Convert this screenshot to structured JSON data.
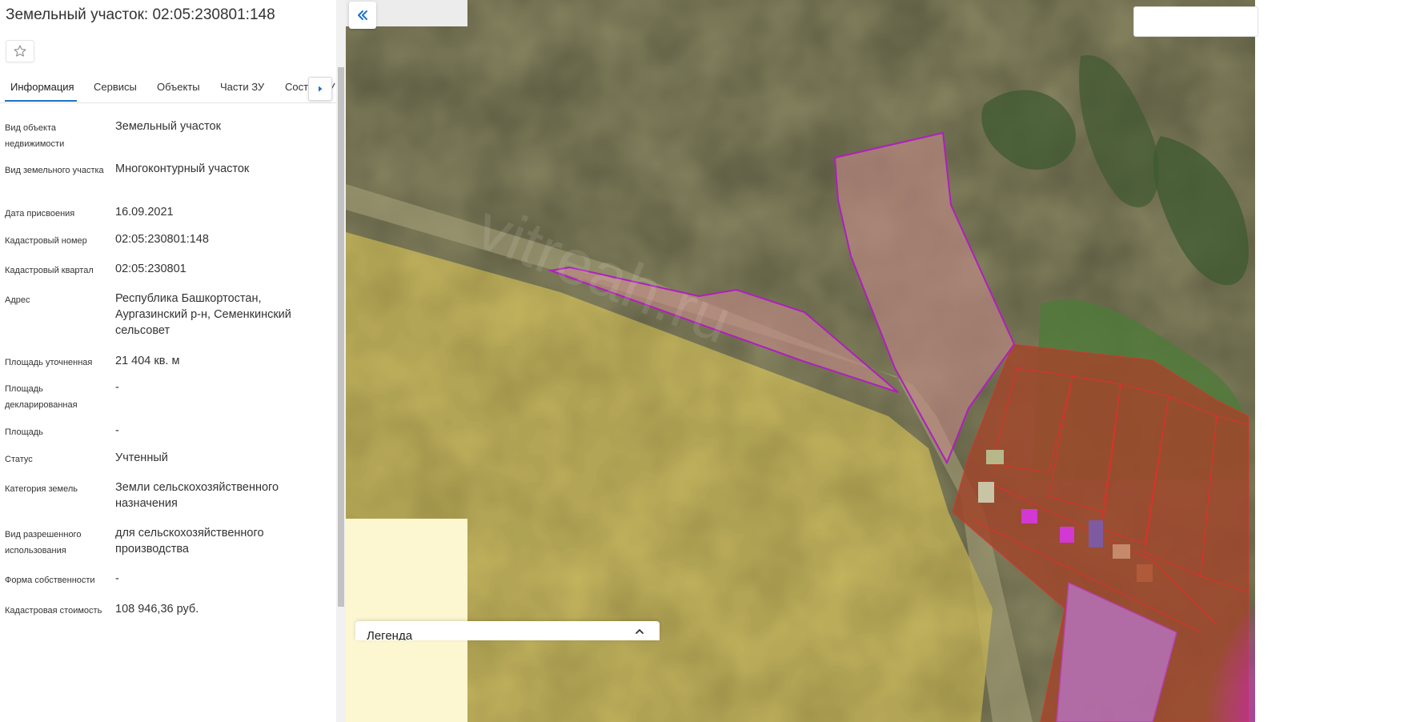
{
  "panel": {
    "title": "Земельный участок: 02:05:230801:148",
    "favorite_icon": "star-icon",
    "tabs": [
      {
        "label": "Информация",
        "active": true
      },
      {
        "label": "Сервисы"
      },
      {
        "label": "Объекты"
      },
      {
        "label": "Части ЗУ"
      },
      {
        "label": "Состав ЗУ"
      }
    ],
    "tabs_next_icon": "caret-right-icon",
    "fields": [
      {
        "label": "Вид объекта недвижимости",
        "value": "Земельный участок"
      },
      {
        "label": "Вид земельного участка",
        "value": "Многоконтурный участок"
      },
      {
        "label": "Дата присвоения",
        "value": "16.09.2021"
      },
      {
        "label": "Кадастровый номер",
        "value": "02:05:230801:148"
      },
      {
        "label": "Кадастровый квартал",
        "value": "02:05:230801"
      },
      {
        "label": "Адрес",
        "value": "Республика Башкортостан, Аургазинский р-н, Семенкинский сельсовет"
      },
      {
        "label": "Площадь уточненная",
        "value": "21 404 кв. м"
      },
      {
        "label": "Площадь декларированная",
        "value": "-"
      },
      {
        "label": "Площадь",
        "value": "-"
      },
      {
        "label": "Статус",
        "value": "Учтенный"
      },
      {
        "label": "Категория земель",
        "value": "Земли сельскохозяйственного назначения"
      },
      {
        "label": "Вид разрешенного использования",
        "value": "для сельскохозяйственного производства"
      },
      {
        "label": "Форма собственности",
        "value": "-"
      },
      {
        "label": "Кадастровая стоимость",
        "value": "108 946,36 руб."
      }
    ]
  },
  "map": {
    "collapse_icon": "double-chevron-left-icon",
    "watermark": "vitreah.ru",
    "legend": {
      "title": "Легенда",
      "toggle_icon": "chevron-up-icon"
    },
    "colors": {
      "selected_outline": "#b01ec0",
      "parcel_outline": "#e0302a",
      "accent": "#1b73c9"
    }
  }
}
